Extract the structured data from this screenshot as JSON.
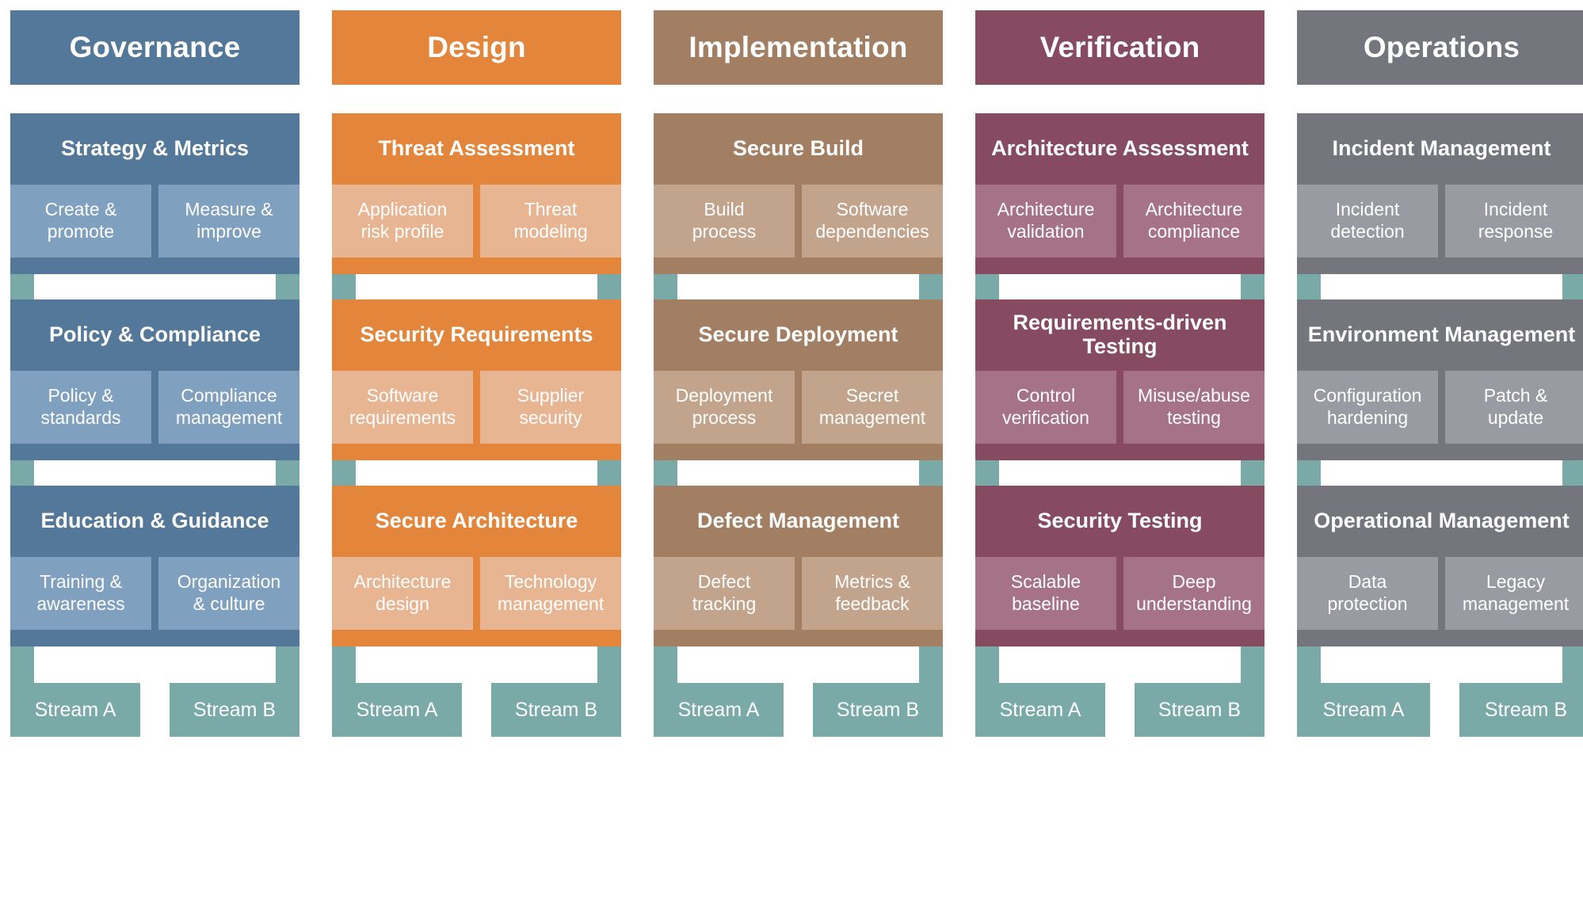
{
  "title": "OWASP SAMM Model Overview",
  "colors": {
    "governance": "#54789A",
    "governance_light": "#7FA0BE",
    "design": "#E3863C",
    "design_light": "#E8B593",
    "implementation": "#A27E62",
    "implementation_light": "#C2A48D",
    "verification": "#864B60",
    "verification_light": "#A67386",
    "operations": "#74757D",
    "operations_light": "#9A9BA2",
    "stream_band": "#79AAA8",
    "background": "#FFFFFF",
    "text": "#FFFFFF"
  },
  "stream_labels": {
    "a": "Stream A",
    "b": "Stream B"
  },
  "business_functions": [
    {
      "name": "Governance",
      "color": "#54789A",
      "light": "#7FA0BE",
      "practices": [
        {
          "name": "Strategy & Metrics",
          "activities": [
            "Create &\npromote",
            "Measure &\nimprove"
          ]
        },
        {
          "name": "Policy & Compliance",
          "activities": [
            "Policy &\nstandards",
            "Compliance\nmanagement"
          ]
        },
        {
          "name": "Education & Guidance",
          "activities": [
            "Training &\nawareness",
            "Organization\n& culture"
          ]
        }
      ]
    },
    {
      "name": "Design",
      "color": "#E3863C",
      "light": "#E8B593",
      "practices": [
        {
          "name": "Threat Assessment",
          "activities": [
            "Application\nrisk profile",
            "Threat\nmodeling"
          ]
        },
        {
          "name": "Security Requirements",
          "activities": [
            "Software\nrequirements",
            "Supplier\nsecurity"
          ]
        },
        {
          "name": "Secure Architecture",
          "activities": [
            "Architecture\ndesign",
            "Technology\nmanagement"
          ]
        }
      ]
    },
    {
      "name": "Implementation",
      "color": "#A27E62",
      "light": "#C2A48D",
      "practices": [
        {
          "name": "Secure Build",
          "activities": [
            "Build\nprocess",
            "Software\ndependencies"
          ]
        },
        {
          "name": "Secure Deployment",
          "activities": [
            "Deployment\nprocess",
            "Secret\nmanagement"
          ]
        },
        {
          "name": "Defect Management",
          "activities": [
            "Defect\ntracking",
            "Metrics &\nfeedback"
          ]
        }
      ]
    },
    {
      "name": "Verification",
      "color": "#864B60",
      "light": "#A67386",
      "practices": [
        {
          "name": "Architecture Assessment",
          "activities": [
            "Architecture\nvalidation",
            "Architecture\ncompliance"
          ]
        },
        {
          "name": "Requirements-driven Testing",
          "activities": [
            "Control\nverification",
            "Misuse/abuse\ntesting"
          ]
        },
        {
          "name": "Security Testing",
          "activities": [
            "Scalable\nbaseline",
            "Deep\nunderstanding"
          ]
        }
      ]
    },
    {
      "name": "Operations",
      "color": "#74757D",
      "light": "#9A9BA2",
      "practices": [
        {
          "name": "Incident Management",
          "activities": [
            "Incident\ndetection",
            "Incident\nresponse"
          ]
        },
        {
          "name": "Environment Management",
          "activities": [
            "Configuration\nhardening",
            "Patch &\nupdate"
          ]
        },
        {
          "name": "Operational Management",
          "activities": [
            "Data\nprotection",
            "Legacy\nmanagement"
          ]
        }
      ]
    }
  ]
}
